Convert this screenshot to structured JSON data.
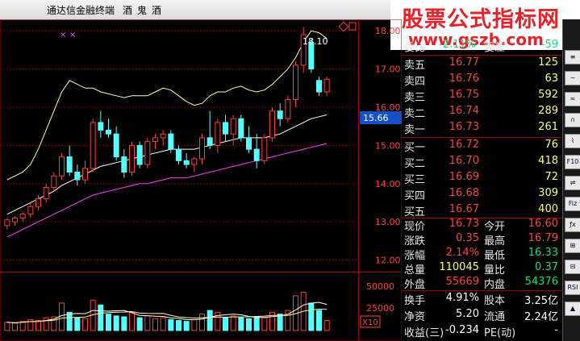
{
  "window": {
    "title": "通达信金融终端",
    "stock_name": "酒鬼酒"
  },
  "watermark": {
    "text": "股票公式指标网",
    "url": "www.gszb.com"
  },
  "chart": {
    "price_axis": [
      "18.00",
      "17.00",
      "16.00",
      "15.00",
      "14.00",
      "13.00",
      "12.00"
    ],
    "current_price_tag": "15.66",
    "high_label": "18.10",
    "volume_axis": [
      "50000",
      "25000"
    ],
    "volume_unit": "X10"
  },
  "chart_data": {
    "type": "candlestick",
    "price_range": [
      11.8,
      18.3
    ],
    "candles": [
      {
        "o": 12.9,
        "h": 13.1,
        "l": 12.8,
        "c": 13.05
      },
      {
        "o": 13.0,
        "h": 13.15,
        "l": 12.9,
        "c": 13.1
      },
      {
        "o": 13.1,
        "h": 13.25,
        "l": 13.0,
        "c": 13.2
      },
      {
        "o": 13.2,
        "h": 13.5,
        "l": 13.1,
        "c": 13.4
      },
      {
        "o": 13.4,
        "h": 13.7,
        "l": 13.3,
        "c": 13.6
      },
      {
        "o": 13.6,
        "h": 14.0,
        "l": 13.5,
        "c": 13.9
      },
      {
        "o": 13.9,
        "h": 14.3,
        "l": 13.8,
        "c": 14.2
      },
      {
        "o": 14.2,
        "h": 14.8,
        "l": 14.1,
        "c": 14.7
      },
      {
        "o": 14.7,
        "h": 15.0,
        "l": 14.2,
        "c": 14.3
      },
      {
        "o": 14.3,
        "h": 14.5,
        "l": 13.95,
        "c": 14.1
      },
      {
        "o": 14.1,
        "h": 14.6,
        "l": 14.0,
        "c": 14.4
      },
      {
        "o": 14.4,
        "h": 15.7,
        "l": 14.3,
        "c": 15.6
      },
      {
        "o": 15.6,
        "h": 15.9,
        "l": 15.2,
        "c": 15.4
      },
      {
        "o": 15.4,
        "h": 15.7,
        "l": 15.2,
        "c": 15.3
      },
      {
        "o": 15.3,
        "h": 15.5,
        "l": 14.6,
        "c": 14.7
      },
      {
        "o": 14.7,
        "h": 14.9,
        "l": 14.15,
        "c": 14.3
      },
      {
        "o": 14.3,
        "h": 15.1,
        "l": 14.2,
        "c": 15.0
      },
      {
        "o": 15.0,
        "h": 15.1,
        "l": 14.4,
        "c": 14.5
      },
      {
        "o": 14.5,
        "h": 15.2,
        "l": 14.4,
        "c": 15.1
      },
      {
        "o": 15.1,
        "h": 15.3,
        "l": 14.9,
        "c": 15.2
      },
      {
        "o": 15.2,
        "h": 15.4,
        "l": 15.0,
        "c": 15.3
      },
      {
        "o": 15.3,
        "h": 15.4,
        "l": 14.8,
        "c": 14.9
      },
      {
        "o": 14.9,
        "h": 15.0,
        "l": 14.5,
        "c": 14.6
      },
      {
        "o": 14.6,
        "h": 14.8,
        "l": 14.4,
        "c": 14.5
      },
      {
        "o": 14.5,
        "h": 14.7,
        "l": 14.3,
        "c": 14.65
      },
      {
        "o": 14.65,
        "h": 15.3,
        "l": 14.5,
        "c": 15.2
      },
      {
        "o": 15.2,
        "h": 15.9,
        "l": 14.9,
        "c": 15.0
      },
      {
        "o": 15.0,
        "h": 15.7,
        "l": 14.8,
        "c": 15.6
      },
      {
        "o": 15.6,
        "h": 15.8,
        "l": 15.1,
        "c": 15.3
      },
      {
        "o": 15.3,
        "h": 15.8,
        "l": 15.0,
        "c": 15.7
      },
      {
        "o": 15.7,
        "h": 15.8,
        "l": 15.1,
        "c": 15.2
      },
      {
        "o": 15.2,
        "h": 15.5,
        "l": 14.8,
        "c": 14.9
      },
      {
        "o": 14.9,
        "h": 15.3,
        "l": 14.4,
        "c": 14.6
      },
      {
        "o": 14.6,
        "h": 15.3,
        "l": 14.5,
        "c": 15.2
      },
      {
        "o": 15.2,
        "h": 16.0,
        "l": 15.1,
        "c": 15.9
      },
      {
        "o": 15.9,
        "h": 16.1,
        "l": 15.5,
        "c": 15.7
      },
      {
        "o": 15.7,
        "h": 16.3,
        "l": 15.6,
        "c": 16.2
      },
      {
        "o": 16.2,
        "h": 17.2,
        "l": 16.0,
        "c": 17.1
      },
      {
        "o": 17.1,
        "h": 18.1,
        "l": 16.9,
        "c": 17.9
      },
      {
        "o": 17.7,
        "h": 17.8,
        "l": 16.9,
        "c": 17.0
      },
      {
        "o": 16.7,
        "h": 16.8,
        "l": 16.3,
        "c": 16.4
      },
      {
        "o": 16.4,
        "h": 16.8,
        "l": 16.3,
        "c": 16.73
      }
    ],
    "ma_upper": [
      14.1,
      14.2,
      14.3,
      14.5,
      14.9,
      15.4,
      15.9,
      16.4,
      16.7,
      16.6,
      16.5,
      16.5,
      16.4,
      16.35,
      16.3,
      16.25,
      16.3,
      16.3,
      16.3,
      16.4,
      16.5,
      16.45,
      16.3,
      16.15,
      16.05,
      16.1,
      16.3,
      16.4,
      16.4,
      16.5,
      16.55,
      16.45,
      16.4,
      16.45,
      16.6,
      16.8,
      17.0,
      17.3,
      17.7,
      18.0,
      17.95,
      17.8
    ],
    "ma_mid": [
      13.2,
      13.3,
      13.4,
      13.5,
      13.6,
      13.7,
      13.8,
      13.95,
      14.05,
      14.15,
      14.25,
      14.35,
      14.45,
      14.5,
      14.55,
      14.6,
      14.65,
      14.7,
      14.75,
      14.8,
      14.85,
      14.9,
      14.9,
      14.9,
      14.9,
      14.95,
      15.0,
      15.05,
      15.1,
      15.15,
      15.2,
      15.2,
      15.2,
      15.2,
      15.25,
      15.3,
      15.4,
      15.5,
      15.6,
      15.7,
      15.75,
      15.8
    ],
    "ma_lower": [
      12.6,
      12.7,
      12.8,
      12.9,
      13.0,
      13.1,
      13.2,
      13.3,
      13.4,
      13.5,
      13.6,
      13.7,
      13.75,
      13.8,
      13.85,
      13.9,
      13.95,
      14.0,
      14.0,
      14.05,
      14.1,
      14.15,
      14.15,
      14.15,
      14.2,
      14.25,
      14.3,
      14.35,
      14.4,
      14.45,
      14.5,
      14.55,
      14.6,
      14.65,
      14.7,
      14.75,
      14.8,
      14.85,
      14.9,
      14.95,
      15.0,
      15.05
    ],
    "volume_range": [
      0,
      60000
    ],
    "volumes": [
      9000,
      8000,
      10000,
      12000,
      11000,
      14000,
      15000,
      30000,
      20000,
      14000,
      13000,
      33000,
      28000,
      18000,
      16000,
      15000,
      20000,
      14000,
      16000,
      13000,
      14000,
      12000,
      11000,
      10000,
      12000,
      18000,
      22000,
      20000,
      14000,
      16000,
      14000,
      13000,
      15000,
      14000,
      20000,
      18000,
      22000,
      38000,
      42000,
      30000,
      22000,
      11000
    ]
  },
  "quote": {
    "weibi": {
      "label": "委比",
      "value": "-2.11%",
      "label2": "委差",
      "value2": "-59"
    },
    "asks": [
      {
        "label": "卖五",
        "price": "16.77",
        "vol": "125"
      },
      {
        "label": "卖四",
        "price": "16.76",
        "vol": "63"
      },
      {
        "label": "卖三",
        "price": "16.75",
        "vol": "592"
      },
      {
        "label": "卖二",
        "price": "16.74",
        "vol": "289"
      },
      {
        "label": "卖一",
        "price": "16.73",
        "vol": "261"
      }
    ],
    "bids": [
      {
        "label": "买一",
        "price": "16.72",
        "vol": "76"
      },
      {
        "label": "买二",
        "price": "16.70",
        "vol": "418"
      },
      {
        "label": "买三",
        "price": "16.69",
        "vol": "72"
      },
      {
        "label": "买四",
        "price": "16.68",
        "vol": "309"
      },
      {
        "label": "买五",
        "price": "16.67",
        "vol": "400"
      }
    ],
    "stats": [
      {
        "l1": "现价",
        "v1": "16.73",
        "l2": "今开",
        "v2": "16.60",
        "c1": "red",
        "c2": "red"
      },
      {
        "l1": "涨跌",
        "v1": "0.35",
        "l2": "最高",
        "v2": "16.79",
        "c1": "red",
        "c2": "red"
      },
      {
        "l1": "涨幅",
        "v1": "2.14%",
        "l2": "最低",
        "v2": "16.33",
        "c1": "red",
        "c2": "green"
      },
      {
        "l1": "总量",
        "v1": "110045",
        "l2": "量比",
        "v2": "0.37",
        "c1": "yellow",
        "c2": "green"
      },
      {
        "l1": "外盘",
        "v1": "55669",
        "l2": "内盘",
        "v2": "54376",
        "c1": "red",
        "c2": "green"
      }
    ],
    "fundamentals": [
      {
        "l1": "换手",
        "v1": "4.91%",
        "l2": "股本",
        "v2": "3.25亿"
      },
      {
        "l1": "净资",
        "v1": "5.20",
        "l2": "流通",
        "v2": "2.24亿"
      },
      {
        "l1": "收益(三)",
        "v1": "-0.234",
        "l2": "PE(动)",
        "v2": "-"
      }
    ]
  },
  "toolbar": {
    "buttons": [
      "≡",
      "~",
      "≈",
      "∩",
      "⌇",
      "F10",
      "⇌",
      "Fiz",
      "ƒx",
      "⊞",
      "⊟",
      "RSI",
      "▲"
    ]
  },
  "colors": {
    "up": "#ff3c3c",
    "down": "#54ffff",
    "ma_upper": "#ffff99",
    "ma_mid": "#ffffff",
    "ma_lower": "#ff40ff",
    "grid": "#a00000"
  }
}
